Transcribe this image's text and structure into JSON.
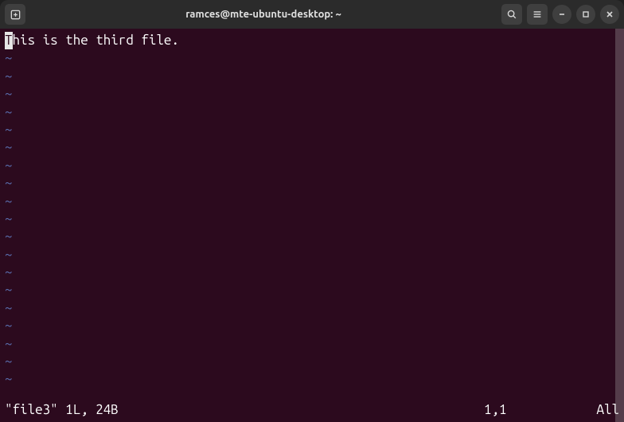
{
  "window": {
    "title": "ramces@mte-ubuntu-desktop: ~"
  },
  "editor": {
    "content_first_char": "T",
    "content_rest": "his is the third file.",
    "empty_marker": "~",
    "empty_line_count": 19
  },
  "status": {
    "file_info": "\"file3\" 1L, 24B",
    "position": "1,1",
    "scroll": "All"
  },
  "icons": {
    "new_tab": "new-tab-icon",
    "search": "search-icon",
    "menu": "menu-icon",
    "minimize": "minimize-icon",
    "maximize": "maximize-icon",
    "close": "close-icon"
  }
}
